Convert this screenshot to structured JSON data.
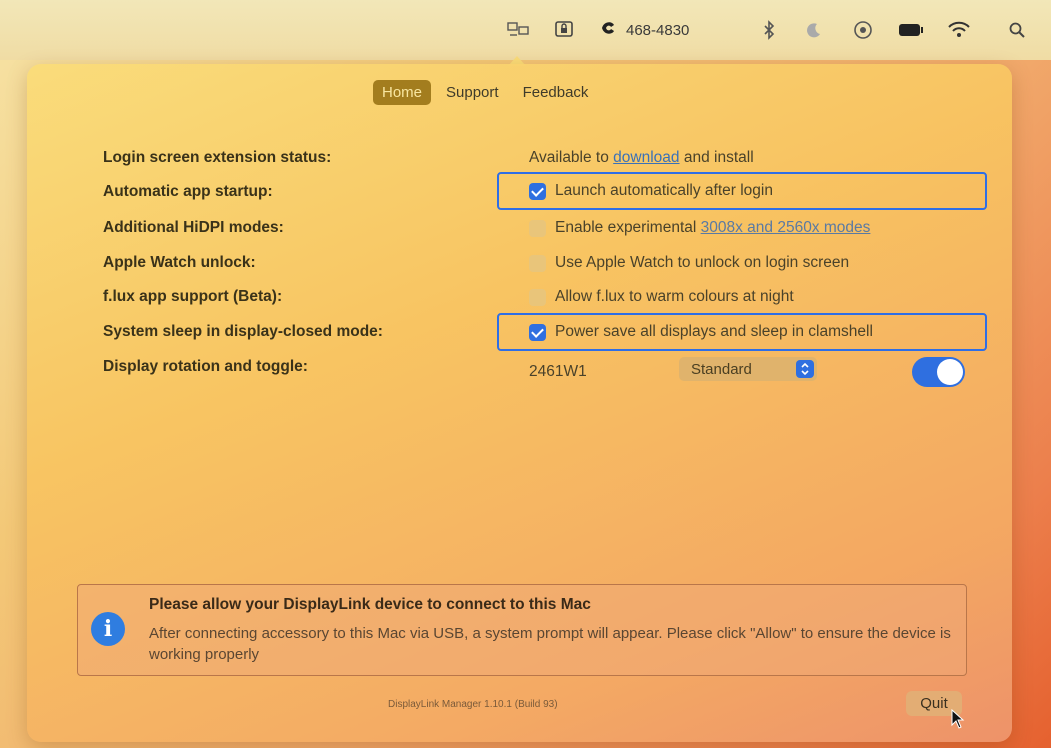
{
  "menubar": {
    "phone_text": "468-4830",
    "icons": [
      "displaylink-icon",
      "screen-lock-icon",
      "phone-icon",
      "bluetooth-icon",
      "moon-icon",
      "target-icon",
      "battery-icon",
      "wifi-icon",
      "search-icon"
    ]
  },
  "tabs": [
    {
      "label": "Home",
      "active": true
    },
    {
      "label": "Support",
      "active": false
    },
    {
      "label": "Feedback",
      "active": false
    }
  ],
  "settings": {
    "login_ext": {
      "label": "Login screen extension status:",
      "prefix": "Available to ",
      "link": "download",
      "suffix": " and install"
    },
    "auto_startup": {
      "label": "Automatic app startup:",
      "option": "Launch automatically after login",
      "checked": true
    },
    "hidpi": {
      "label": "Additional HiDPI modes:",
      "option_prefix": "Enable experimental ",
      "option_link": "3008x and 2560x modes",
      "checked": false
    },
    "watch_unlock": {
      "label": "Apple Watch unlock:",
      "option": "Use Apple Watch to unlock on login screen",
      "checked": false
    },
    "flux": {
      "label": "f.lux app support (Beta):",
      "option": "Allow f.lux to warm colours at night",
      "checked": false
    },
    "sleep": {
      "label": "System sleep in display-closed mode:",
      "option": "Power save all displays and sleep in clamshell",
      "checked": true
    },
    "rotation": {
      "label": "Display rotation and toggle:",
      "display_name": "2461W1",
      "rotation_value": "Standard",
      "toggle_on": true
    }
  },
  "notice": {
    "title": "Please allow your DisplayLink device to connect to this Mac",
    "body": "After connecting accessory to this Mac via USB, a system prompt will appear. Please click \"Allow\" to ensure the device is working properly"
  },
  "footer": {
    "version": "DisplayLink Manager 1.10.1 (Build 93)",
    "quit_label": "Quit"
  },
  "colors": {
    "accent": "#2f6fe0",
    "tab_active": "#a37d1e",
    "highlight": "#2e6ee6"
  }
}
